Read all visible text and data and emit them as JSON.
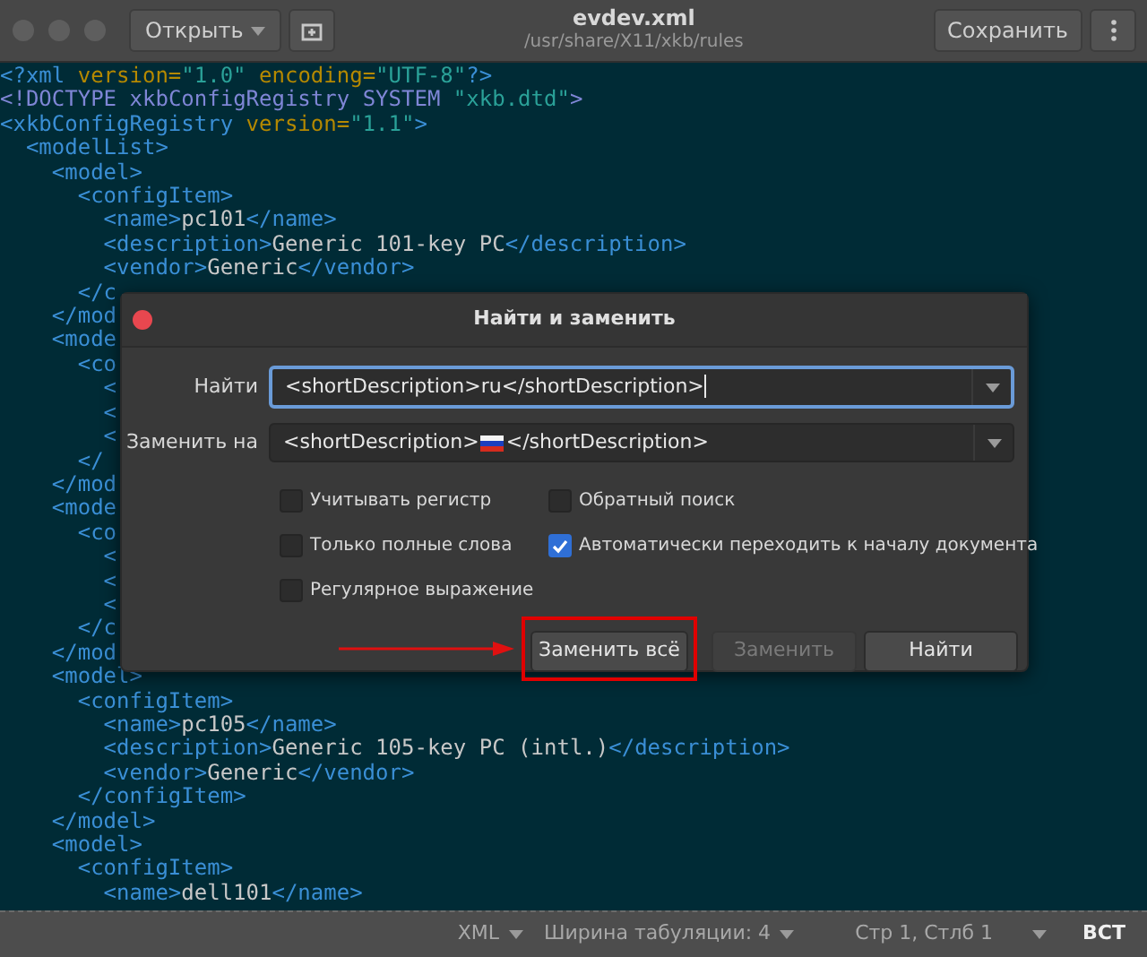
{
  "window": {
    "title": "evdev.xml",
    "subtitle": "/usr/share/X11/xkb/rules"
  },
  "toolbar": {
    "open_button": "Открыть",
    "save_button": "Сохранить"
  },
  "editor": {
    "lines": [
      "<?xml version=\"1.0\" encoding=\"UTF-8\"?>",
      "<!DOCTYPE xkbConfigRegistry SYSTEM \"xkb.dtd\">",
      "<xkbConfigRegistry version=\"1.1\">",
      "  <modelList>",
      "    <model>",
      "      <configItem>",
      "        <name>pc101</name>",
      "        <description>Generic 101-key PC</description>",
      "        <vendor>Generic</vendor>",
      "      </c",
      "    </mod",
      "    <mode",
      "      <co",
      "        <",
      "        <",
      "        <",
      "      </",
      "    </mod",
      "    <mode",
      "      <co",
      "        <",
      "        <",
      "        <",
      "      </c",
      "    </mod",
      "    <model>",
      "      <configItem>",
      "        <name>pc105</name>",
      "        <description>Generic 105-key PC (intl.)</description>",
      "        <vendor>Generic</vendor>",
      "      </configItem>",
      "    </model>",
      "    <model>",
      "      <configItem>",
      "        <name>dell101</name>"
    ]
  },
  "dialog": {
    "title": "Найти и заменить",
    "find": {
      "label": "Найти",
      "value": "<shortDescription>ru</shortDescription>",
      "focused": true
    },
    "replace": {
      "label": "Заменить на",
      "value_start": "<shortDescription>",
      "value_end": "</shortDescription>",
      "focused": false
    },
    "options": [
      {
        "label": "Учитывать регистр",
        "checked": false
      },
      {
        "label": "Обратный поиск",
        "checked": false
      },
      {
        "label": "Только полные слова",
        "checked": false
      },
      {
        "label": "Автоматически переходить к началу документа",
        "checked": true
      },
      {
        "label": "Регулярное выражение",
        "checked": false
      }
    ],
    "buttons": [
      {
        "label": "Заменить всё",
        "disabled": false,
        "highlighted": true
      },
      {
        "label": "Заменить",
        "disabled": true,
        "highlighted": false
      },
      {
        "label": "Найти",
        "disabled": false,
        "highlighted": false
      }
    ]
  },
  "status_bar": {
    "language": "XML",
    "tab_width": "Ширина табуляции: 4",
    "position": "Стр 1, Стлб 1",
    "insert_mode": "ВСТ"
  }
}
